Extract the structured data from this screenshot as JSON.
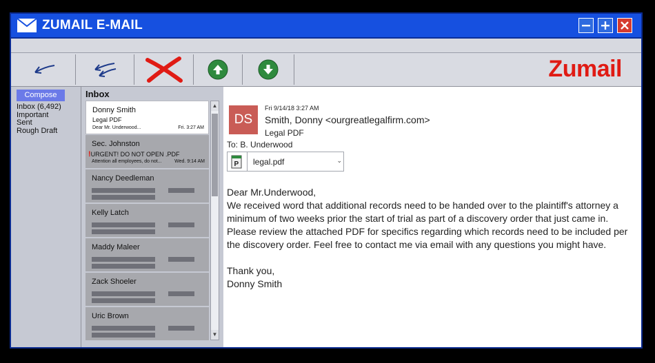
{
  "window": {
    "title": "ZUMAIL E-MAIL",
    "logo": "Zumail"
  },
  "folders": {
    "compose_label": "Compose",
    "items": [
      "Inbox (6,492)",
      "Important",
      "Sent",
      "Rough Draft"
    ]
  },
  "inbox": {
    "label": "Inbox",
    "items": [
      {
        "from": "Donny Smith",
        "subject": "Legal PDF",
        "preview": "Dear Mr. Underwood...",
        "time": "Fri. 3:27 AM"
      },
      {
        "from": "Sec. Johnston",
        "subject": "URGENT! DO NOT OPEN .PDF",
        "preview": "Attention all employees, do not...",
        "time": "Wed. 9:14 AM"
      },
      {
        "from": "Nancy Deedleman"
      },
      {
        "from": "Kelly Latch"
      },
      {
        "from": "Maddy Maleer"
      },
      {
        "from": "Zack Shoeler"
      },
      {
        "from": "Uric Brown"
      }
    ]
  },
  "message": {
    "avatar": "DS",
    "date": "Fri 9/14/18 3:27 AM",
    "from": "Smith, Donny <ourgreatlegalfirm.com>",
    "subject": "Legal PDF",
    "to": "To: B. Underwood",
    "attachment": "legal.pdf",
    "greeting": "Dear Mr.Underwood,",
    "body": "We received word that additional records need to be handed over to the plaintiff's attorney a minimum of two weeks prior the start of trial as part of a discovery order that just came in. Please review the attached PDF for specifics regarding which records need to be included per the discovery order. Feel free to contact me via email with any questions you might have.",
    "closing": "Thank you,",
    "signature": "Donny Smith"
  },
  "colors": {
    "titlebar": "#1650e0",
    "logo": "#e01b14",
    "avatar": "#c95c56",
    "compose": "#6b7ae8"
  },
  "icons": [
    "mail-icon",
    "minimize-icon",
    "maximize-icon",
    "close-icon",
    "reply-icon",
    "reply-all-icon",
    "delete-icon",
    "up-arrow-icon",
    "down-arrow-icon",
    "pdf-icon"
  ]
}
